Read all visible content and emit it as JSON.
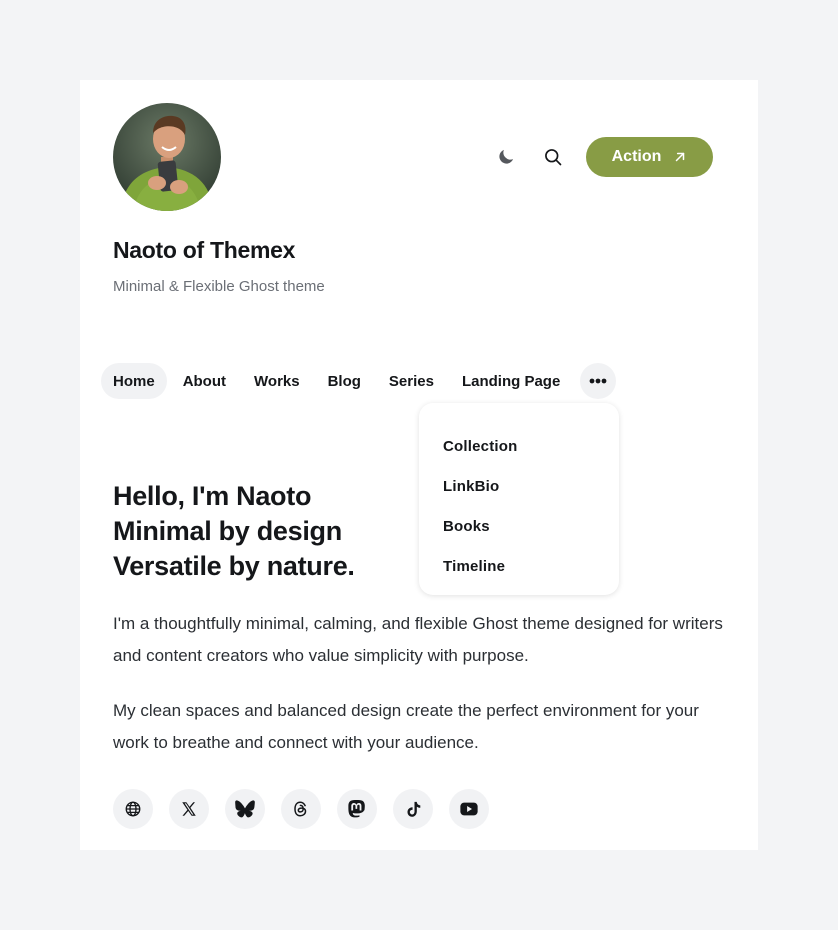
{
  "header": {
    "avatar_alt": "Naoto of Themex avatar",
    "theme_toggle_icon": "moon-icon",
    "search_icon": "search-icon",
    "action_label": "Action",
    "action_icon": "arrow-up-right-icon",
    "accent_color": "#889c45"
  },
  "site": {
    "title": "Naoto of Themex",
    "description": "Minimal & Flexible Ghost theme"
  },
  "nav": {
    "items": [
      {
        "label": "Home",
        "active": true
      },
      {
        "label": "About"
      },
      {
        "label": "Works"
      },
      {
        "label": "Blog"
      },
      {
        "label": "Series"
      },
      {
        "label": "Landing Page"
      }
    ],
    "more_icon": "more-dots-icon",
    "dropdown": [
      "Collection",
      "LinkBio",
      "Books",
      "Timeline"
    ]
  },
  "hero": {
    "lines": [
      "Hello, I'm Naoto",
      "Minimal by design",
      "Versatile by nature."
    ],
    "paragraph1": "I'm a thoughtfully minimal, calming, and flexible Ghost theme designed for writers and content creators who value simplicity with purpose.",
    "paragraph2": "My clean spaces and balanced design create the perfect environment for your work to breathe and connect with your audience."
  },
  "socials": [
    "globe-icon",
    "x-icon",
    "bluesky-icon",
    "threads-icon",
    "mastodon-icon",
    "tiktok-icon",
    "youtube-icon"
  ]
}
